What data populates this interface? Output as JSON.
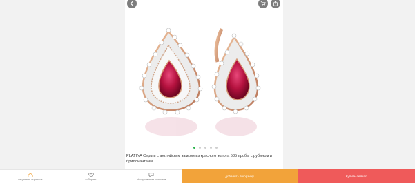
{
  "header": {
    "back_icon": "chevron-left-icon",
    "cart_icon": "cart-icon",
    "share_icon": "share-icon"
  },
  "gallery": {
    "slide_count": 5,
    "active_index": 0,
    "accent_color": "#29b34a"
  },
  "product": {
    "title": "PLATINA Серьги с английским замком из красного золота 585 пробы с рубином и бриллиантами"
  },
  "bottom_nav": {
    "items": [
      {
        "label": "титульная страница",
        "icon": "home-icon"
      },
      {
        "label": "собирать",
        "icon": "heart-icon"
      },
      {
        "label": "обслуживание клиентов",
        "icon": "chat-icon"
      }
    ],
    "add_to_cart_label": "добавить в корзину",
    "buy_now_label": "Купить сейчас",
    "add_to_cart_color": "#f2a33a",
    "buy_now_color": "#ef5a5a",
    "active_color": "#f2a33a"
  }
}
